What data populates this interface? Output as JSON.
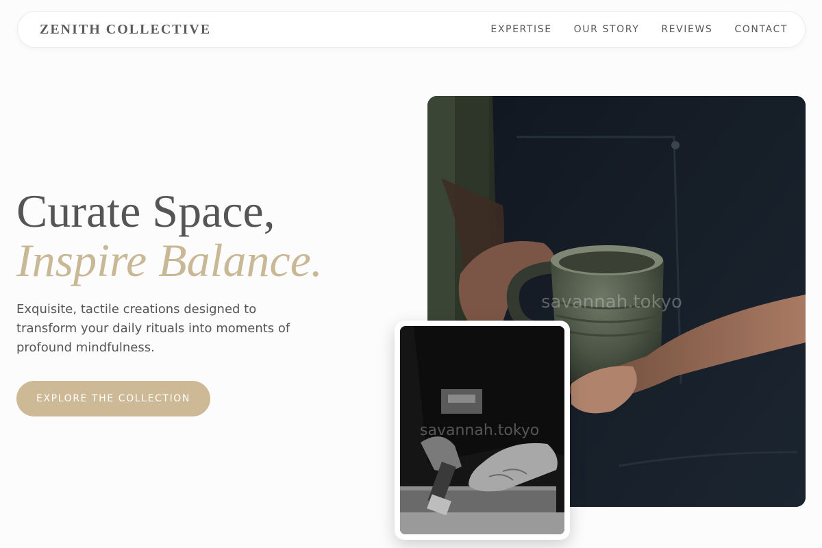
{
  "brand": {
    "name": "ZENITH COLLECTIVE"
  },
  "nav": {
    "links": [
      "EXPERTISE",
      "OUR STORY",
      "REVIEWS",
      "CONTACT"
    ]
  },
  "hero": {
    "headline_line1": "Curate Space,",
    "headline_line2": "Inspire Balance.",
    "tagline": "Exquisite, tactile creations designed to transform your daily rituals into moments of profound mindfulness.",
    "cta_label": "EXPLORE THE COLLECTION"
  },
  "images": {
    "main": {
      "subject": "hands-holding-ceramic-mug-photo",
      "watermark": "savannah.tokyo"
    },
    "inset": {
      "subject": "woodworking-hands-photo",
      "watermark": "savannah.tokyo"
    }
  },
  "colors": {
    "accent": "#c9b896",
    "button": "#cdb995",
    "text": "#555555",
    "background": "#fcfcfc"
  }
}
